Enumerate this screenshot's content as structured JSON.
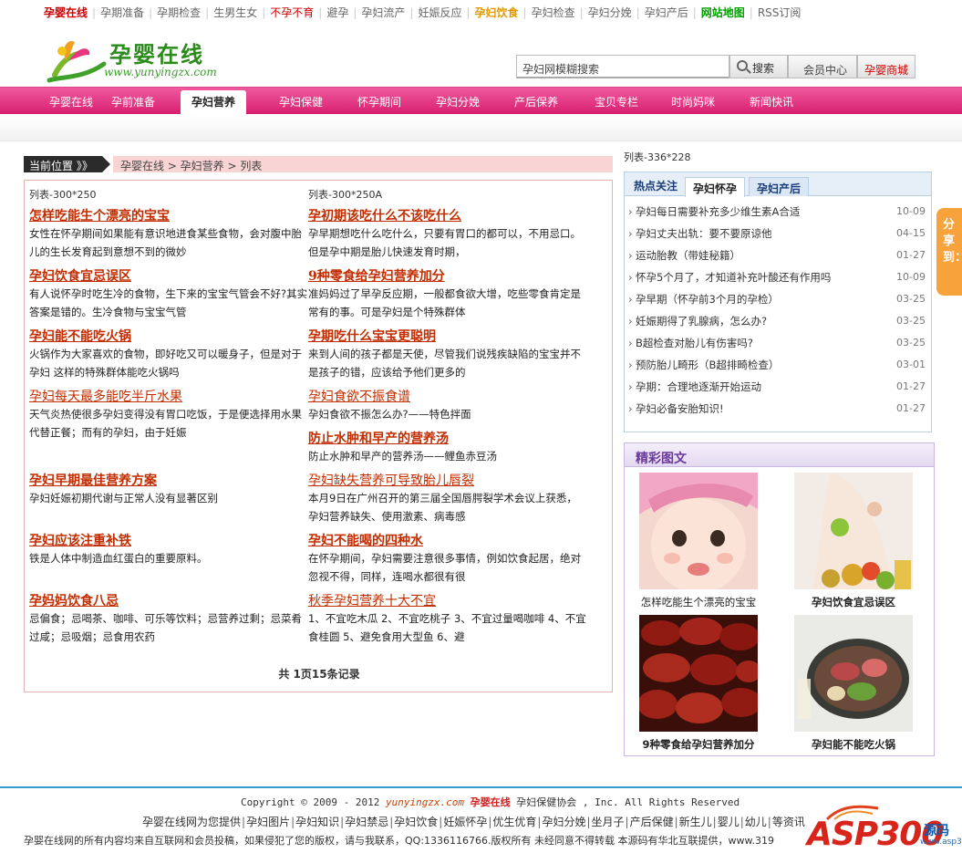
{
  "top_links": [
    {
      "label": "孕婴在线",
      "style": "red bold"
    },
    {
      "label": "孕期准备",
      "style": ""
    },
    {
      "label": "孕期检查",
      "style": ""
    },
    {
      "label": "生男生女",
      "style": ""
    },
    {
      "label": "不孕不育",
      "style": "red"
    },
    {
      "label": "避孕",
      "style": ""
    },
    {
      "label": "孕妇流产",
      "style": ""
    },
    {
      "label": "妊娠反应",
      "style": ""
    },
    {
      "label": "孕妇饮食",
      "style": "gold bold"
    },
    {
      "label": "孕妇检查",
      "style": ""
    },
    {
      "label": "孕妇分娩",
      "style": ""
    },
    {
      "label": "孕妇产后",
      "style": ""
    },
    {
      "label": "网站地图",
      "style": "green bold"
    },
    {
      "label": "RSS订阅",
      "style": ""
    }
  ],
  "logo": {
    "title": "孕婴在线",
    "url": "www.yunyingzx.com"
  },
  "search": {
    "value": "孕妇网模糊搜索",
    "button": "搜索",
    "member": "会员中心",
    "mall": "孕婴商城"
  },
  "nav": {
    "items": [
      "孕婴在线",
      "孕前准备",
      "孕妇营养",
      "孕妇保健",
      "怀孕期间",
      "孕妇分娩",
      "产后保养",
      "宝贝专栏",
      "时尚妈咪",
      "新闻快讯"
    ],
    "active_index": 2
  },
  "breadcrumb": {
    "label": "当前位置 》》",
    "path": "孕婴在线 > 孕妇营养 > 列表"
  },
  "ads": {
    "left": "列表-300*250",
    "right": "列表-300*250A",
    "side": "列表-336*228"
  },
  "articles_left": [
    {
      "title": "怎样吃能生个漂亮的宝宝",
      "desc": "女性在怀孕期间如果能有意识地进食某些食物，会对腹中胎儿的生长发育起到意想不到的微妙",
      "light": false
    },
    {
      "title": "孕妇饮食宜忌误区",
      "desc": "有人说怀孕时吃生冷的食物，生下来的宝宝气管会不好?其实答案是错的。生冷食物与宝宝气管",
      "light": false
    },
    {
      "title": "孕妇能不能吃火锅",
      "desc": "火锅作为大家喜欢的食物，即好吃又可以暖身子，但是对于 孕妇 这样的特殊群体能吃火锅吗",
      "light": false
    },
    {
      "title": "孕妇每天最多能吃半斤水果",
      "desc": "天气炎热使很多孕妇变得没有胃口吃饭，于是便选择用水果代替正餐；而有的孕妇，由于妊娠",
      "light": true
    },
    {
      "title": "孕妇早期最佳营养方案",
      "desc": "孕妇妊娠初期代谢与正常人没有显著区别",
      "light": false
    },
    {
      "title": "孕妇应该注重补铁",
      "desc": "铁是人体中制造血红蛋白的重要原料。",
      "light": false
    },
    {
      "title": "孕妈妈饮食八忌",
      "desc": "忌偏食；忌喝茶、咖啡、可乐等饮料；忌营养过剩；忌菜肴过咸；忌吸烟；忌食用农药",
      "light": false
    }
  ],
  "articles_right": [
    {
      "title": "孕初期该吃什么不该吃什么",
      "desc": "孕早期想吃什么吃什么，只要有胃口的都可以，不用忌口。但是孕中期是胎儿快速发育时期，",
      "light": false
    },
    {
      "title": "9种零食给孕妇营养加分",
      "desc": "准妈妈过了早孕反应期，一般都食欲大增，吃些零食肯定是常有的事。可是孕妇是个特殊群体",
      "light": false
    },
    {
      "title": "孕期吃什么宝宝更聪明",
      "desc": "来到人间的孩子都是天使，尽管我们说残疾缺陷的宝宝并不是孩子的错，应该给予他们更多的",
      "light": false
    },
    {
      "title": "孕妇食欲不振食谱",
      "desc": "孕妇食欲不振怎么办?——特色拌面",
      "light": true
    },
    {
      "title": "防止水肿和早产的营养汤",
      "desc": "防止水肿和早产的营养汤——鲤鱼赤豆汤",
      "light": false
    },
    {
      "title": "孕妇缺失营养可导致胎儿唇裂",
      "desc": "本月9日在广州召开的第三届全国唇腭裂学术会议上获悉，孕妇营养缺失、使用激素、病毒感",
      "light": true
    },
    {
      "title": "孕妇不能喝的四种水",
      "desc": "在怀孕期间，孕妇需要注意很多事情，例如饮食起居，绝对忽视不得，同样，连喝水都很有很",
      "light": false
    },
    {
      "title": "秋季孕妇营养十大不宜",
      "desc": "1、不宜吃木瓜 2、不宜吃桃子 3、不宜过量喝咖啡 4、不宜食桂圆 5、避免食用大型鱼 6、避",
      "light": true
    }
  ],
  "pager": "共 1页15条记录",
  "hot": {
    "label": "热点关注",
    "tabs": [
      "孕妇怀孕",
      "孕妇产后"
    ],
    "active_tab": 0,
    "items": [
      {
        "title": "孕妇每日需要补充多少维生素A合适",
        "date": "10-09"
      },
      {
        "title": "孕妇丈夫出轨：要不要原谅他",
        "date": "04-15"
      },
      {
        "title": "运动胎教（带娃秘籍）",
        "date": "01-27"
      },
      {
        "title": "怀孕5个月了，才知道补充叶酸还有作用吗",
        "date": "10-09"
      },
      {
        "title": "孕早期（怀孕前3个月的孕检）",
        "date": "03-25"
      },
      {
        "title": "妊娠期得了乳腺病，怎么办?",
        "date": "03-25"
      },
      {
        "title": "B超检查对胎儿有伤害吗?",
        "date": "03-25"
      },
      {
        "title": "预防胎儿畸形（B超排畸检查）",
        "date": "03-01"
      },
      {
        "title": "孕期：合理地逐渐开始运动",
        "date": "01-27"
      },
      {
        "title": "孕妇必备安胎知识!",
        "date": "01-27"
      }
    ]
  },
  "gallery": {
    "title": "精彩图文",
    "items": [
      {
        "caption": "怎样吃能生个漂亮的宝宝",
        "bold": false
      },
      {
        "caption": "孕妇饮食宜忌误区",
        "bold": true
      },
      {
        "caption": "9种零食给孕妇营养加分",
        "bold": true
      },
      {
        "caption": "孕妇能不能吃火锅",
        "bold": true
      }
    ]
  },
  "share": "分享到：",
  "footer": {
    "copyright_prefix": "Copyright © 2009 - 2012 ",
    "copyright_url": "yunyingzx.com",
    "copyright_brand": "孕婴在线",
    "copyright_suffix": " 孕妇保健协会 , Inc. All Rights Reserved",
    "links_intro": "孕婴在线网为您提供",
    "links": [
      "孕妇图片",
      "孕妇知识",
      "孕妇禁忌",
      "孕妇饮食",
      "妊娠怀孕",
      "优生优育",
      "孕妇分娩",
      "坐月子",
      "产后保健",
      "新生儿",
      "婴儿",
      "幼儿",
      "等资讯"
    ],
    "note": "孕婴在线网的所有内容均来自互联网和会员投稿，如果侵犯了您的版权，请与我联系，QQ:1336116766.版权所有 未经同意不得转载 本源码有华北互联提供，www.319"
  },
  "watermark": {
    "text": "ASP300",
    "cn": "源码",
    "sub": "www.asp300.com"
  },
  "colors": {
    "nav_pink": "#e8357f",
    "title_red": "#c22d00",
    "hot_blue": "#1a3c78",
    "gallery_purple": "#6a3a9a"
  }
}
